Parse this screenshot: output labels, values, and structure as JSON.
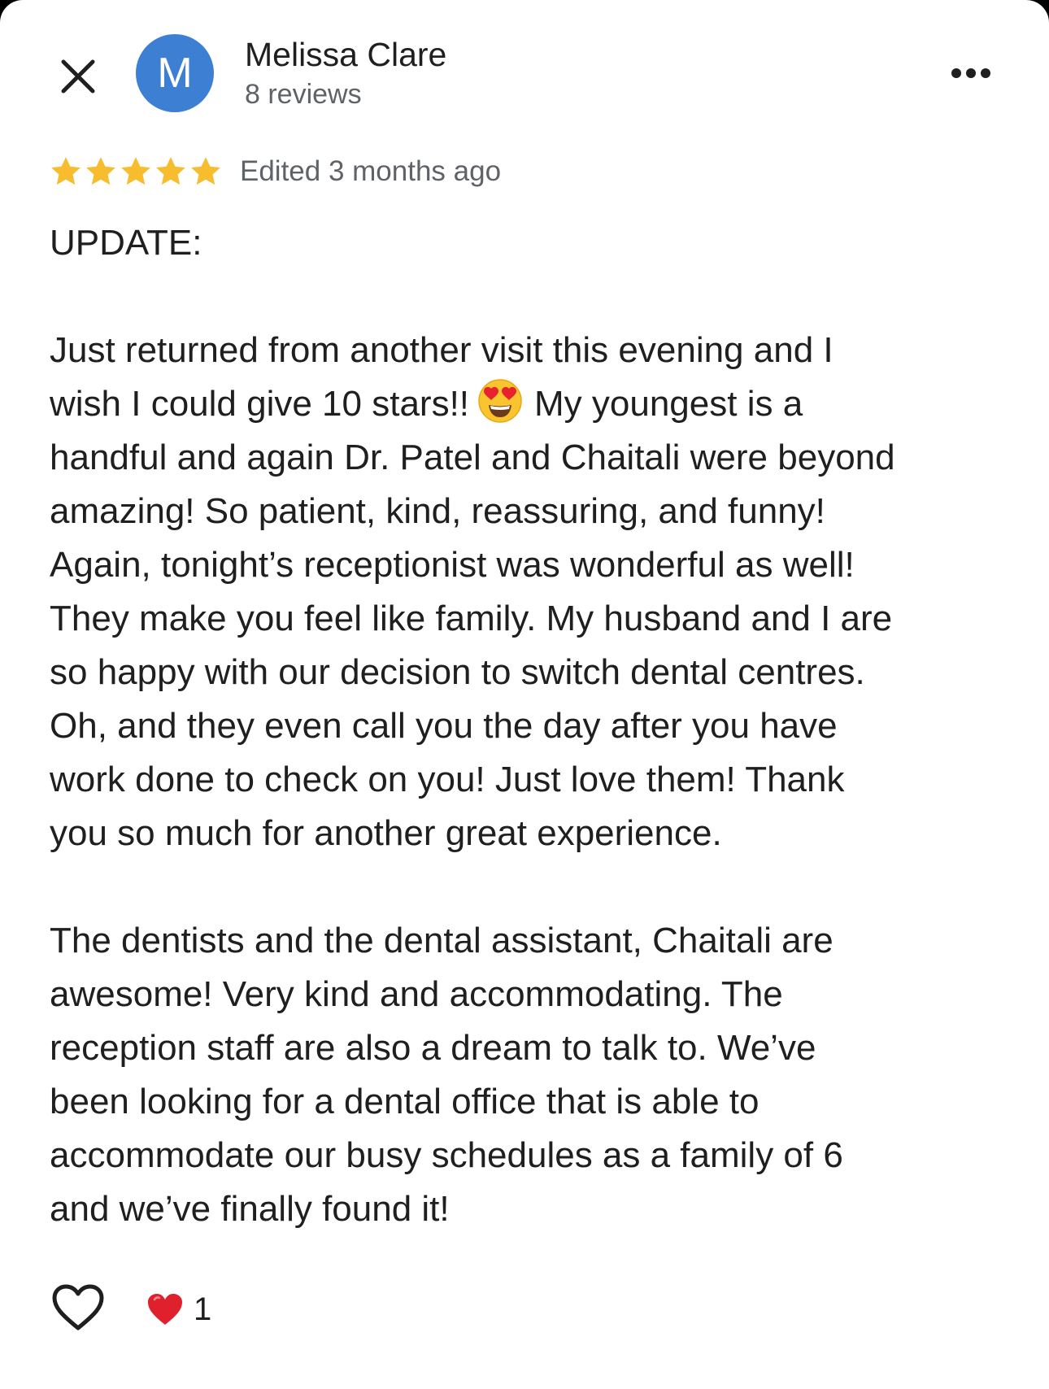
{
  "header": {
    "close_icon": "close-icon",
    "avatar_initial": "M",
    "avatar_color": "#3d7fd3",
    "author_name": "Melissa Clare",
    "review_count": "8 reviews",
    "more_icon": "more-horiz-icon"
  },
  "review": {
    "rating": 5,
    "rating_max": 5,
    "star_color": "#f7bd2f",
    "timestamp": "Edited 3 months ago",
    "body": {
      "update_heading": "UPDATE:",
      "update_lines": [
        "Just returned from another visit this evening and I",
        "wish I could give 10 stars!!",
        "My youngest is a",
        "handful and again Dr. Patel and Chaitali were beyond",
        "amazing! So patient, kind, reassuring, and funny!",
        "Again, tonight’s receptionist was wonderful as well!",
        "They make you feel like family. My husband and I are",
        "so happy with our decision to switch dental centres.",
        "Oh, and they even call you the day after you have",
        "work done to check on you! Just love them! Thank",
        "you so much for another great experience."
      ],
      "inline_emoji": "heart-eyes-emoji",
      "original_lines": [
        "The dentists and the dental assistant, Chaitali are",
        "awesome! Very kind and accommodating. The",
        "reception staff are also a dream to talk to. We’ve",
        "been looking for a dental office that is able to",
        "accommodate our busy schedules as a family of 6",
        "and we’ve finally found it!"
      ]
    }
  },
  "footer": {
    "like_icon": "heart-outline-icon",
    "reaction_icon": "red-heart-icon",
    "reaction_color": "#e0202c",
    "reaction_count": "1"
  }
}
